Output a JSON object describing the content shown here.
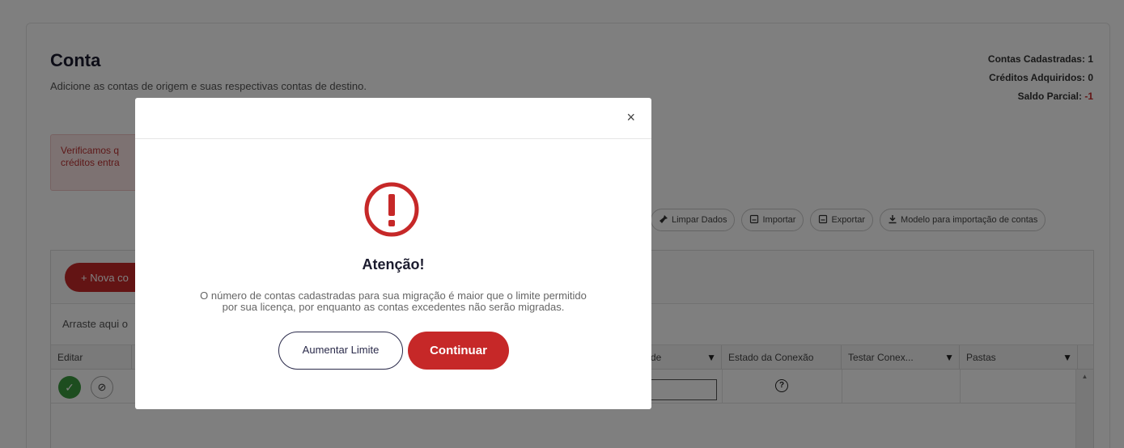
{
  "page": {
    "title": "Conta",
    "subtitle": "Adicione as contas de origem e suas respectivas contas de destino.",
    "stats": [
      {
        "label": "Contas Cadastradas:",
        "value": "1"
      },
      {
        "label": "Créditos Adquiridos:",
        "value": "0"
      },
      {
        "label": "Saldo Parcial:",
        "value": "-1"
      }
    ],
    "alert_lines": [
      "Verificamos q",
      "créditos entra"
    ]
  },
  "toolbar": {
    "clear": {
      "label": "Limpar Dados",
      "icon": "broom-icon"
    },
    "import": {
      "label": "Importar",
      "icon": "file-icon"
    },
    "export": {
      "label": "Exportar",
      "icon": "file-icon"
    },
    "template": {
      "label": "Modelo para importação de contas",
      "icon": "download-icon"
    }
  },
  "grid": {
    "new_button": "+ Nova co",
    "drag_hint": "Arraste aqui o",
    "columns": [
      {
        "label": "Editar"
      },
      {
        "label": "de"
      },
      {
        "label": "Estado da Conexão"
      },
      {
        "label": "Testar Conex..."
      },
      {
        "label": "Pastas"
      }
    ],
    "row": {
      "status_glyph": "?"
    }
  },
  "modal": {
    "title": "Atenção!",
    "message_line1": "O número de contas cadastradas para sua migração é maior que o limite permitido",
    "message_line2": "por sua licença, por enquanto as contas excedentes não serão migradas.",
    "secondary_button": "Aumentar Limite",
    "primary_button": "Continuar",
    "close_glyph": "×",
    "accent_color": "#c62828"
  }
}
